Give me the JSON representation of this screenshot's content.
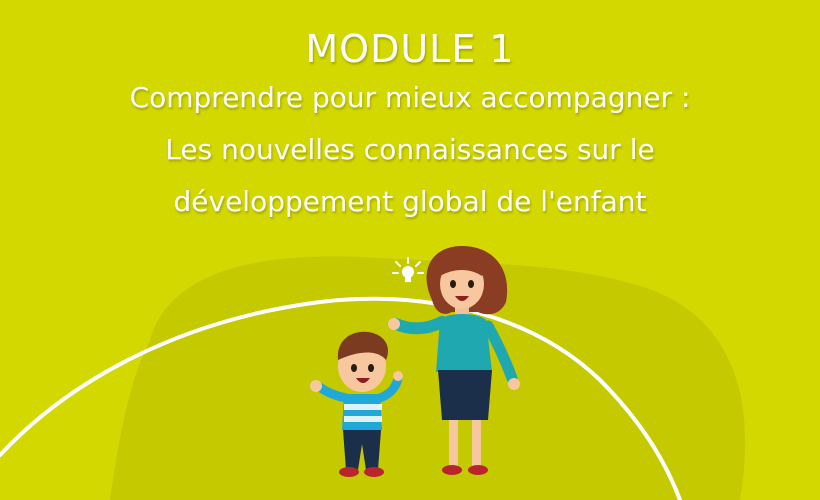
{
  "header": {
    "module": "MODULE 1",
    "subtitle_lines": [
      "Comprendre pour mieux accompagner :",
      "Les nouvelles connaissances sur le",
      "développement global de l'enfant"
    ]
  },
  "colors": {
    "background": "#d3d800",
    "hill": "#c5c900",
    "text": "#ffffff",
    "curve": "#ffffff"
  },
  "illustration": {
    "figures": [
      "woman-figure",
      "boy-figure"
    ],
    "icon": "lightbulb-icon"
  }
}
